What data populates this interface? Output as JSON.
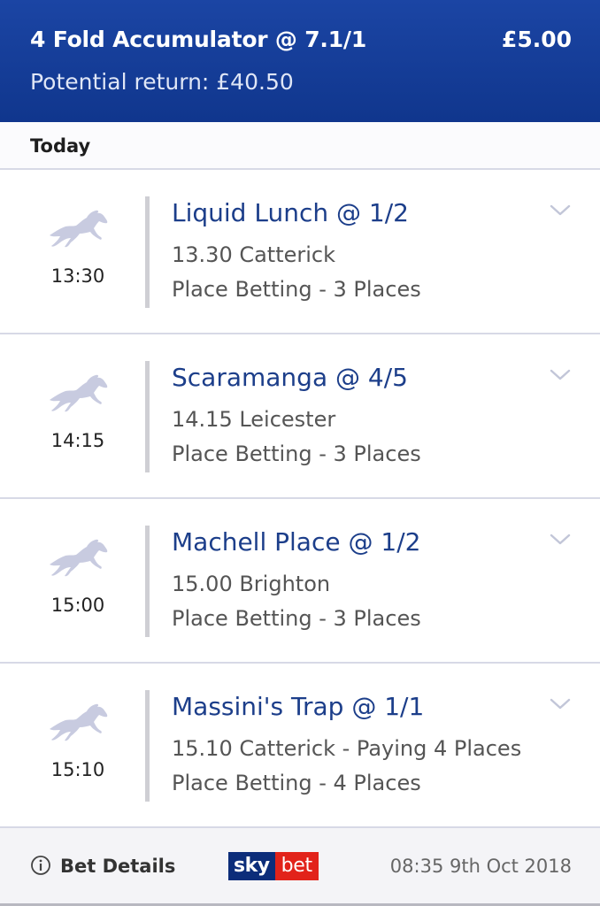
{
  "header": {
    "title": "4 Fold Accumulator @ 7.1/1",
    "stake": "£5.00",
    "potential_return": "Potential return: £40.50",
    "background_color": "#10368d"
  },
  "day": {
    "label": "Today"
  },
  "selections": [
    {
      "time": "13:30",
      "name": "Liquid Lunch @ 1/2",
      "event": "13.30 Catterick",
      "market": "Place Betting - 3 Places",
      "icon": "horse-racing-icon"
    },
    {
      "time": "14:15",
      "name": "Scaramanga @ 4/5",
      "event": "14.15 Leicester",
      "market": "Place Betting - 3 Places",
      "icon": "horse-racing-icon"
    },
    {
      "time": "15:00",
      "name": "Machell Place @ 1/2",
      "event": "15.00 Brighton",
      "market": "Place Betting - 3 Places",
      "icon": "horse-racing-icon"
    },
    {
      "time": "15:10",
      "name": "Massini's Trap @ 1/1",
      "event": "15.10 Catterick - Paying 4 Places",
      "market": "Place Betting - 4 Places",
      "icon": "horse-racing-icon"
    }
  ],
  "footer": {
    "bet_details_label": "Bet Details",
    "logo": {
      "sky": "sky",
      "bet": "bet"
    },
    "timestamp": "08:35 9th Oct 2018"
  },
  "colors": {
    "selection_name": "#1c3e8a",
    "logo_sky": "#0c2d7a",
    "logo_bet": "#e2231a",
    "horse_icon": "#c8cbe0"
  }
}
